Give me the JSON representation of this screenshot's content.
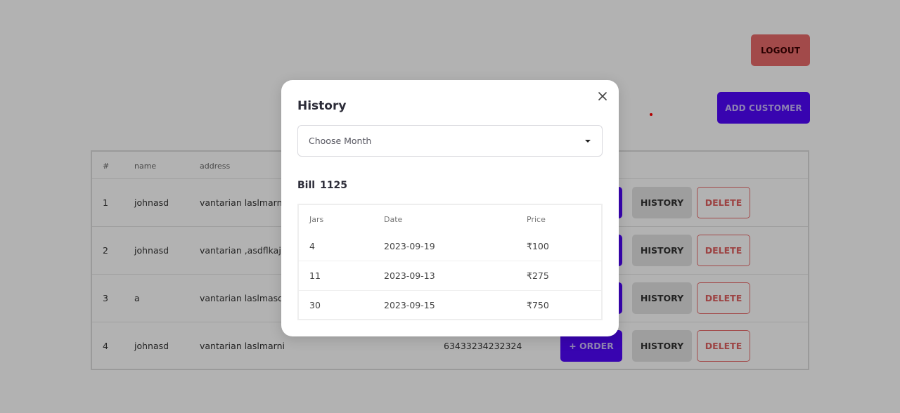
{
  "header": {
    "logout_label": "LOGOUT",
    "add_customer_label": "ADD CUSTOMER"
  },
  "customers": {
    "columns": [
      "#",
      "name",
      "address"
    ],
    "rows": [
      {
        "index": "1",
        "name": "johnasd",
        "address": "vantarian laslmarni",
        "phone": "",
        "order_label": "+ ORDER",
        "history_label": "HISTORY",
        "delete_label": "DELETE"
      },
      {
        "index": "2",
        "name": "johnasd",
        "address": "vantarian ,asdflkajsd",
        "phone": "",
        "order_label": "+ ORDER",
        "history_label": "HISTORY",
        "delete_label": "DELETE"
      },
      {
        "index": "3",
        "name": "a",
        "address": "vantarian laslmasdar",
        "phone": "",
        "order_label": "+ ORDER",
        "history_label": "HISTORY",
        "delete_label": "DELETE"
      },
      {
        "index": "4",
        "name": "johnasd",
        "address": "vantarian laslmarni",
        "phone": "63433234232324",
        "order_label": "+ ORDER",
        "history_label": "HISTORY",
        "delete_label": "DELETE"
      }
    ]
  },
  "modal": {
    "title": "History",
    "close_icon": "close-icon",
    "month_select": {
      "value": "Choose Month"
    },
    "bill_label": "Bill",
    "bill_total": "1125",
    "columns": [
      "Jars",
      "Date",
      "Price"
    ],
    "rows": [
      {
        "jars": "4",
        "date": "2023-09-19",
        "price": "₹100"
      },
      {
        "jars": "11",
        "date": "2023-09-13",
        "price": "₹275"
      },
      {
        "jars": "30",
        "date": "2023-09-15",
        "price": "₹750"
      }
    ]
  },
  "colors": {
    "primary": "#5107fc",
    "danger": "#e96b6b"
  }
}
